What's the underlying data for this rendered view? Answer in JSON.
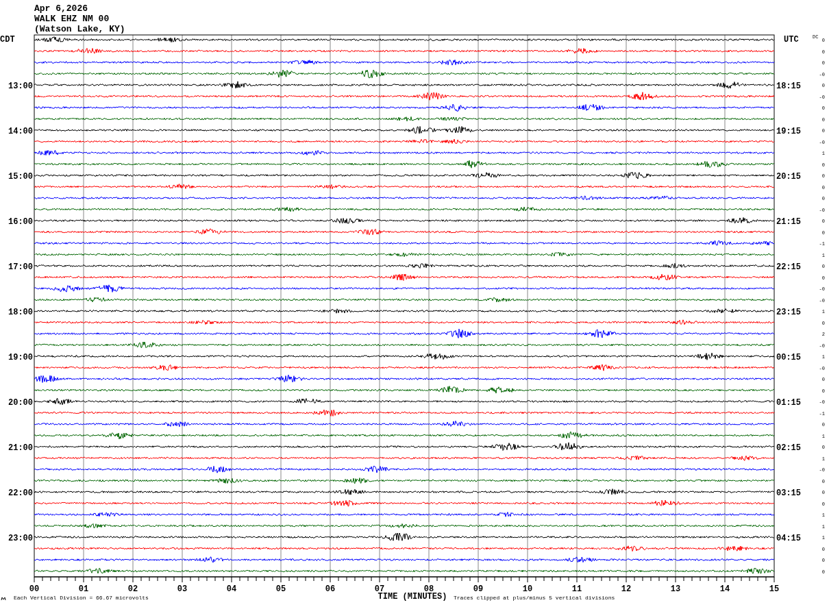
{
  "header": {
    "date": "Apr 6,2026",
    "station": "WALK EHZ NM 00",
    "location": "(Watson Lake, KY)"
  },
  "left_axis_title": "CDT",
  "right_axis_title": "UTC",
  "dc_title": "DC",
  "traces": [
    {
      "color": "#000000",
      "dc": "0"
    },
    {
      "color": "#ff0000",
      "dc": "0"
    },
    {
      "color": "#0000ff",
      "dc": "0"
    },
    {
      "color": "#006400",
      "dc": "-0"
    },
    {
      "color": "#000000",
      "dc": "0",
      "local_time": "13:00",
      "utc_time": "18:15"
    },
    {
      "color": "#ff0000",
      "dc": "-0"
    },
    {
      "color": "#0000ff",
      "dc": "0"
    },
    {
      "color": "#006400",
      "dc": "0"
    },
    {
      "color": "#000000",
      "dc": "0",
      "local_time": "14:00",
      "utc_time": "19:15"
    },
    {
      "color": "#ff0000",
      "dc": "-0"
    },
    {
      "color": "#0000ff",
      "dc": "1"
    },
    {
      "color": "#006400",
      "dc": "0"
    },
    {
      "color": "#000000",
      "dc": "0",
      "local_time": "15:00",
      "utc_time": "20:15"
    },
    {
      "color": "#ff0000",
      "dc": "0"
    },
    {
      "color": "#0000ff",
      "dc": "0"
    },
    {
      "color": "#006400",
      "dc": "-0"
    },
    {
      "color": "#000000",
      "dc": "0",
      "local_time": "16:00",
      "utc_time": "21:15"
    },
    {
      "color": "#ff0000",
      "dc": "0"
    },
    {
      "color": "#0000ff",
      "dc": "-1"
    },
    {
      "color": "#006400",
      "dc": "1"
    },
    {
      "color": "#000000",
      "dc": "0",
      "local_time": "17:00",
      "utc_time": "22:15"
    },
    {
      "color": "#ff0000",
      "dc": "0"
    },
    {
      "color": "#0000ff",
      "dc": "-0"
    },
    {
      "color": "#006400",
      "dc": "-0"
    },
    {
      "color": "#000000",
      "dc": "1",
      "local_time": "18:00",
      "utc_time": "23:15"
    },
    {
      "color": "#ff0000",
      "dc": "0"
    },
    {
      "color": "#0000ff",
      "dc": "2"
    },
    {
      "color": "#006400",
      "dc": "-0"
    },
    {
      "color": "#000000",
      "dc": "1",
      "local_time": "19:00",
      "utc_time": "00:15"
    },
    {
      "color": "#ff0000",
      "dc": "-0"
    },
    {
      "color": "#0000ff",
      "dc": "0"
    },
    {
      "color": "#006400",
      "dc": "0"
    },
    {
      "color": "#000000",
      "dc": "-0",
      "local_time": "20:00",
      "utc_time": "01:15"
    },
    {
      "color": "#ff0000",
      "dc": "-1"
    },
    {
      "color": "#0000ff",
      "dc": "0"
    },
    {
      "color": "#006400",
      "dc": "1"
    },
    {
      "color": "#000000",
      "dc": "0",
      "local_time": "21:00",
      "utc_time": "02:15"
    },
    {
      "color": "#ff0000",
      "dc": "1"
    },
    {
      "color": "#0000ff",
      "dc": "-0"
    },
    {
      "color": "#006400",
      "dc": "0"
    },
    {
      "color": "#000000",
      "dc": "0",
      "local_time": "22:00",
      "utc_time": "03:15"
    },
    {
      "color": "#ff0000",
      "dc": "0"
    },
    {
      "color": "#0000ff",
      "dc": "1"
    },
    {
      "color": "#006400",
      "dc": "1"
    },
    {
      "color": "#000000",
      "dc": "1",
      "local_time": "23:00",
      "utc_time": "04:15"
    },
    {
      "color": "#ff0000",
      "dc": "0"
    },
    {
      "color": "#0000ff",
      "dc": "0"
    },
    {
      "color": "#006400",
      "dc": "0"
    }
  ],
  "x_ticks": [
    "00",
    "01",
    "02",
    "03",
    "04",
    "05",
    "06",
    "07",
    "08",
    "09",
    "10",
    "11",
    "12",
    "13",
    "14",
    "15"
  ],
  "x_axis_title": "TIME (MINUTES)",
  "footer": {
    "scale_note": "Each Vertical Division =   66.67 microvolts",
    "clip_note": "Traces clipped at plus/minus 5 vertical divisions"
  }
}
